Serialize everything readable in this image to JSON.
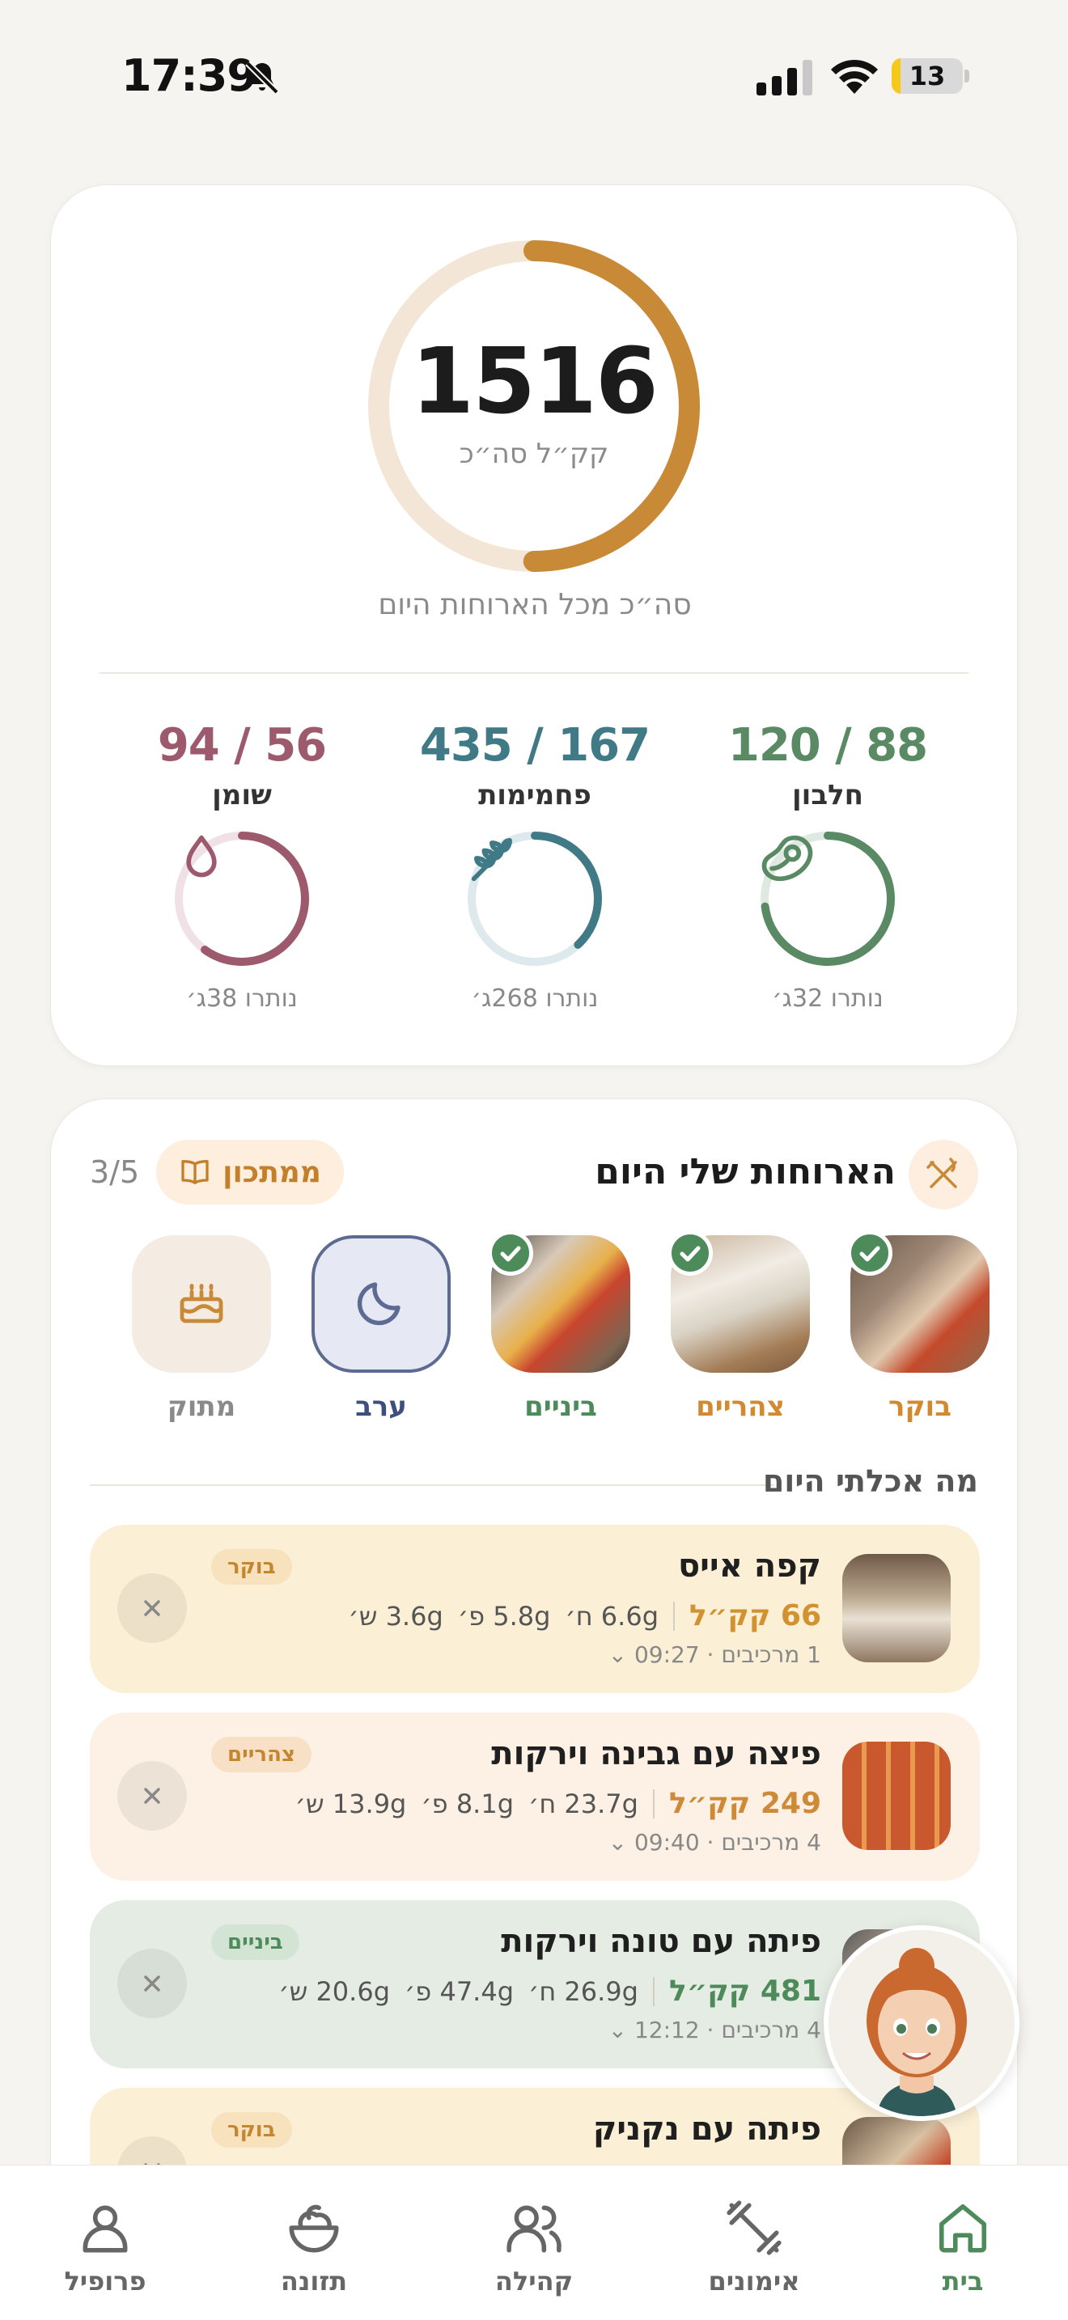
{
  "status_bar": {
    "time": "17:39",
    "battery": "13",
    "battery_level": 0.13
  },
  "summary": {
    "total_kcal": "1516",
    "total_unit": "קק״ל סה״כ",
    "caption": "סה״כ מכל הארוחות היום",
    "ring_progress": 0.5,
    "macros": [
      {
        "key": "protein",
        "value": "120 / 88",
        "label": "חלבון",
        "remaining": "נותרו 32ג׳",
        "color": "#5a8a64",
        "progress": 0.73
      },
      {
        "key": "carbs",
        "value": "435 / 167",
        "label": "פחמימות",
        "remaining": "נותרו 268ג׳",
        "color": "#3f7a86",
        "progress": 0.38
      },
      {
        "key": "fat",
        "value": "94 / 56",
        "label": "שומן",
        "remaining": "נותרו 38ג׳",
        "color": "#9c5a6c",
        "progress": 0.6
      }
    ]
  },
  "meals": {
    "title": "הארוחות שלי היום",
    "recipe_button": "ממתכון",
    "count": "3/5",
    "section_title": "מה אכלתי היום",
    "tiles": [
      {
        "label": "בוקר",
        "color": "#d3892f",
        "done": true
      },
      {
        "label": "צהריים",
        "color": "#d3892f",
        "done": true
      },
      {
        "label": "ביניים",
        "color": "#4d8b5a",
        "done": true
      },
      {
        "label": "ערב",
        "color": "#3d4f7c",
        "done": false
      },
      {
        "label": "מתוק",
        "color": "#8a8a8a",
        "done": false
      }
    ],
    "entries": [
      {
        "name": "קפה אייס",
        "kcal": "66 קק״ל",
        "protein": "6.6g ח׳",
        "carbs": "5.8g פ׳",
        "fat": "3.6g ש׳",
        "meta": "1 מרכיבים · 09:27",
        "tag": "בוקר",
        "bg": "#fbefd6",
        "tag_bg": "#f8e2bd",
        "tag_color": "#c4862f",
        "kcal_color": "#d1922f"
      },
      {
        "name": "פיצה עם גבינה וירקות",
        "kcal": "249 קק״ל",
        "protein": "23.7g ח׳",
        "carbs": "8.1g פ׳",
        "fat": "13.9g ש׳",
        "meta": "4 מרכיבים · 09:40",
        "tag": "צהריים",
        "bg": "#fcf1e4",
        "tag_bg": "#f8e0c6",
        "tag_color": "#c4862f",
        "kcal_color": "#cf8a37"
      },
      {
        "name": "פיתה עם טונה וירקות",
        "kcal": "481 קק״ל",
        "protein": "26.9g ח׳",
        "carbs": "47.4g פ׳",
        "fat": "20.6g ש׳",
        "meta": "4 מרכיבים · 12:12",
        "tag": "ביניים",
        "bg": "#e5ece4",
        "tag_bg": "#d4e4d4",
        "tag_color": "#4d8b5a",
        "kcal_color": "#4d8b5a"
      },
      {
        "name": "פיתה עם נקניק",
        "kcal": "",
        "protein": "",
        "carbs": "",
        "fat": "",
        "meta": "",
        "tag": "בוקר",
        "bg": "#fbefd6",
        "tag_bg": "#f8e2bd",
        "tag_color": "#c4862f",
        "kcal_color": "#d1922f"
      }
    ]
  },
  "nav": {
    "items": [
      {
        "label": "בית",
        "active": true
      },
      {
        "label": "אימונים",
        "active": false
      },
      {
        "label": "קהילה",
        "active": false
      },
      {
        "label": "תזונה",
        "active": false
      },
      {
        "label": "פרופיל",
        "active": false
      }
    ],
    "active_color": "#4d8b5a",
    "inactive_color": "#666666"
  }
}
